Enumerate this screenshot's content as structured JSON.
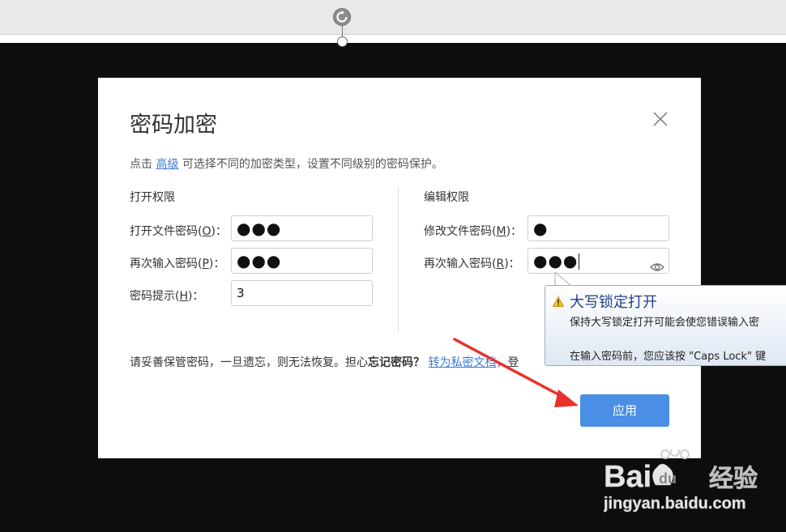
{
  "dialog": {
    "title": "密码加密",
    "desc_prefix": "点击 ",
    "desc_link": "高级",
    "desc_suffix": " 可选择不同的加密类型，设置不同级别的密码保护。",
    "open_section": {
      "title": "打开权限",
      "password_label": "打开文件密码(",
      "password_key": "O",
      "password_label_end": ")：",
      "password_value": "●●●",
      "confirm_label": "再次输入密码(",
      "confirm_key": "P",
      "confirm_label_end": ")：",
      "confirm_value": "●●●",
      "hint_label": "密码提示(",
      "hint_key": "H",
      "hint_label_end": ")：",
      "hint_value": "3"
    },
    "edit_section": {
      "title": "编辑权限",
      "password_label": "修改文件密码(",
      "password_key": "M",
      "password_label_end": ")：",
      "password_value": "●",
      "confirm_label": "再次输入密码(",
      "confirm_key": "R",
      "confirm_label_end": ")：",
      "confirm_value": "●●●"
    },
    "note_prefix": "请妥善保管密码，一旦遗忘，则无法恢复。担心",
    "note_bold": "忘记密码？",
    "note_link": "转为私密文档",
    "note_suffix": "，登",
    "apply_button": "应用"
  },
  "tooltip": {
    "title": "大写锁定打开",
    "line1": "保持大写锁定打开可能会使您错误输入密",
    "line2": "在输入密码前，您应该按 \"Caps Lock\" 键"
  },
  "watermark": {
    "brand": "Bai",
    "brand_tail": "经验",
    "url": "jingyan.baidu.com"
  },
  "colors": {
    "accent": "#4a8ee6",
    "link": "#3b7bd6",
    "arrow": "#e8312a",
    "background": "#0d0d0d"
  }
}
